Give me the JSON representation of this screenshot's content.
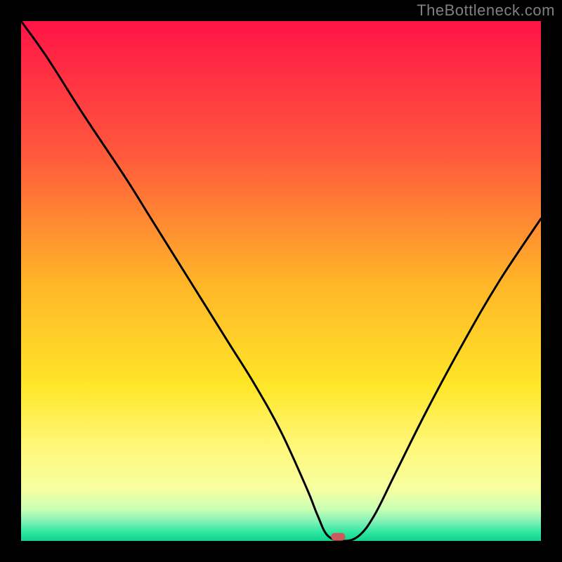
{
  "watermark": "TheBottleneck.com",
  "chart_data": {
    "type": "line",
    "title": "",
    "xlabel": "",
    "ylabel": "",
    "xlim": [
      0,
      100
    ],
    "ylim": [
      0,
      100
    ],
    "series": [
      {
        "name": "bottleneck-curve",
        "x": [
          0,
          5,
          12,
          20,
          25,
          30,
          35,
          40,
          45,
          50,
          55,
          57,
          59,
          62,
          65,
          68,
          72,
          78,
          85,
          92,
          100
        ],
        "values": [
          100,
          93,
          82,
          70,
          62,
          54,
          46,
          38,
          30,
          21,
          10,
          5,
          1,
          0,
          1,
          5,
          13,
          25,
          38,
          50,
          62
        ]
      }
    ],
    "marker": {
      "x": 61,
      "y": 0.8,
      "label": "optimal-point"
    },
    "gradient_stops": [
      {
        "offset": 0,
        "color": "#ff1446"
      },
      {
        "offset": 0.26,
        "color": "#ff5a3c"
      },
      {
        "offset": 0.5,
        "color": "#ffb428"
      },
      {
        "offset": 0.7,
        "color": "#ffe628"
      },
      {
        "offset": 0.82,
        "color": "#fff87a"
      },
      {
        "offset": 0.9,
        "color": "#f7ffa0"
      },
      {
        "offset": 0.94,
        "color": "#c8ffb4"
      },
      {
        "offset": 0.965,
        "color": "#78f0b4"
      },
      {
        "offset": 0.985,
        "color": "#28e6a0"
      },
      {
        "offset": 1.0,
        "color": "#14d28c"
      }
    ]
  }
}
